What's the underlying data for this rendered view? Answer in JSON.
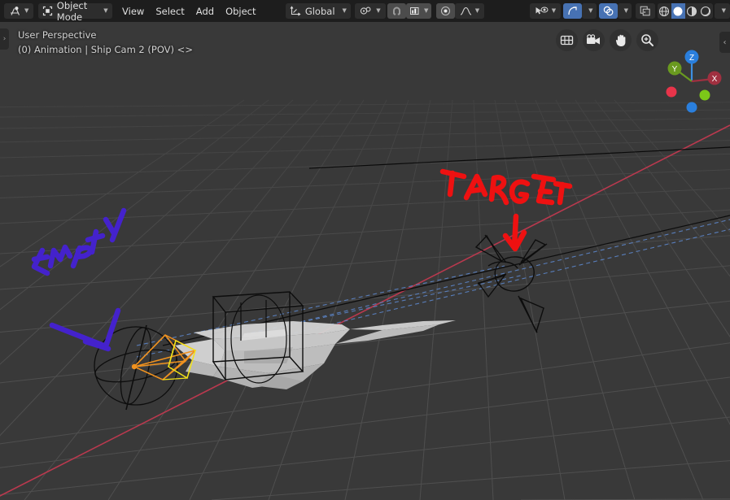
{
  "app": {
    "name": "Blender",
    "editor": "3D Viewport"
  },
  "header": {
    "editor_type_icon": "editor-type-icon",
    "mode": {
      "label": "Object Mode",
      "icon": "object-mode-icon"
    },
    "menus": [
      "View",
      "Select",
      "Add",
      "Object"
    ],
    "transform_orientation": {
      "label": "Global",
      "icon": "transform-orientation-icon"
    },
    "snap_with": {
      "icon": "snap-with-icon"
    },
    "snap_magnet": {
      "icon": "magnet-icon",
      "active": true
    },
    "snap_target": {
      "icon": "snap-target-icon"
    },
    "proportional_edit": {
      "icon": "proportional-edit-icon",
      "active": true
    },
    "proportional_falloff": {
      "icon": "falloff-curve-icon"
    },
    "visibility": {
      "icon": "object-visibility-icon"
    },
    "gizmo": {
      "icon": "gizmo-icon",
      "active": true
    },
    "overlays": {
      "icon": "overlays-icon",
      "active": true
    },
    "xray": {
      "icon": "xray-toggle-icon"
    },
    "shading": {
      "modes": [
        {
          "name": "wireframe",
          "icon": "shading-wireframe-icon",
          "active": false
        },
        {
          "name": "solid",
          "icon": "shading-solid-icon",
          "active": true
        },
        {
          "name": "material",
          "icon": "shading-material-icon",
          "active": false
        },
        {
          "name": "rendered",
          "icon": "shading-rendered-icon",
          "active": false
        }
      ]
    }
  },
  "viewport": {
    "info_line_1": "User Perspective",
    "info_line_2": "(0) Animation | Ship Cam 2 (POV) <>",
    "nav_buttons": [
      {
        "name": "toggle-orthographic",
        "icon": "grid-ortho-icon"
      },
      {
        "name": "toggle-camera-view",
        "icon": "camera-icon"
      },
      {
        "name": "pan-view",
        "icon": "hand-icon"
      },
      {
        "name": "zoom-view",
        "icon": "zoom-magnifier-icon"
      }
    ],
    "axis_gizmo": {
      "axes": [
        {
          "label": "Z",
          "color": "#2a7fdd",
          "positive": true
        },
        {
          "label": "Y",
          "color": "#6a9a1f",
          "positive": true
        },
        {
          "label": "X",
          "color": "#a03040",
          "positive": true
        },
        {
          "label": "",
          "color": "#e8344a",
          "positive": false
        },
        {
          "label": "",
          "color": "#7cc818",
          "positive": false
        },
        {
          "label": "",
          "color": "#2a7fdd",
          "positive": false
        }
      ]
    },
    "left_sidebar_toggle": "›",
    "right_sidebar_toggle": "‹",
    "annotations": [
      {
        "text": "Empty",
        "color": "#4422cc",
        "name": "annotation-empty"
      },
      {
        "text": "TARGET",
        "color": "#ee1111",
        "name": "annotation-target"
      }
    ],
    "objects": [
      {
        "name": "empty-sphere",
        "type": "empty",
        "selected": false
      },
      {
        "name": "ship-camera",
        "type": "camera",
        "selected": true,
        "color": "#f08c1e"
      },
      {
        "name": "ship-mesh",
        "type": "mesh",
        "selected": false,
        "color": "#c8c8c8"
      },
      {
        "name": "target-star",
        "type": "mesh",
        "selected": false
      }
    ],
    "colors": {
      "background": "#393939",
      "grid_line": "#4d4d4d",
      "axis_x": "#cc3355",
      "wire": "#000000",
      "relationship_line": "#5c85c8",
      "selected_active": "#f5a623"
    }
  }
}
